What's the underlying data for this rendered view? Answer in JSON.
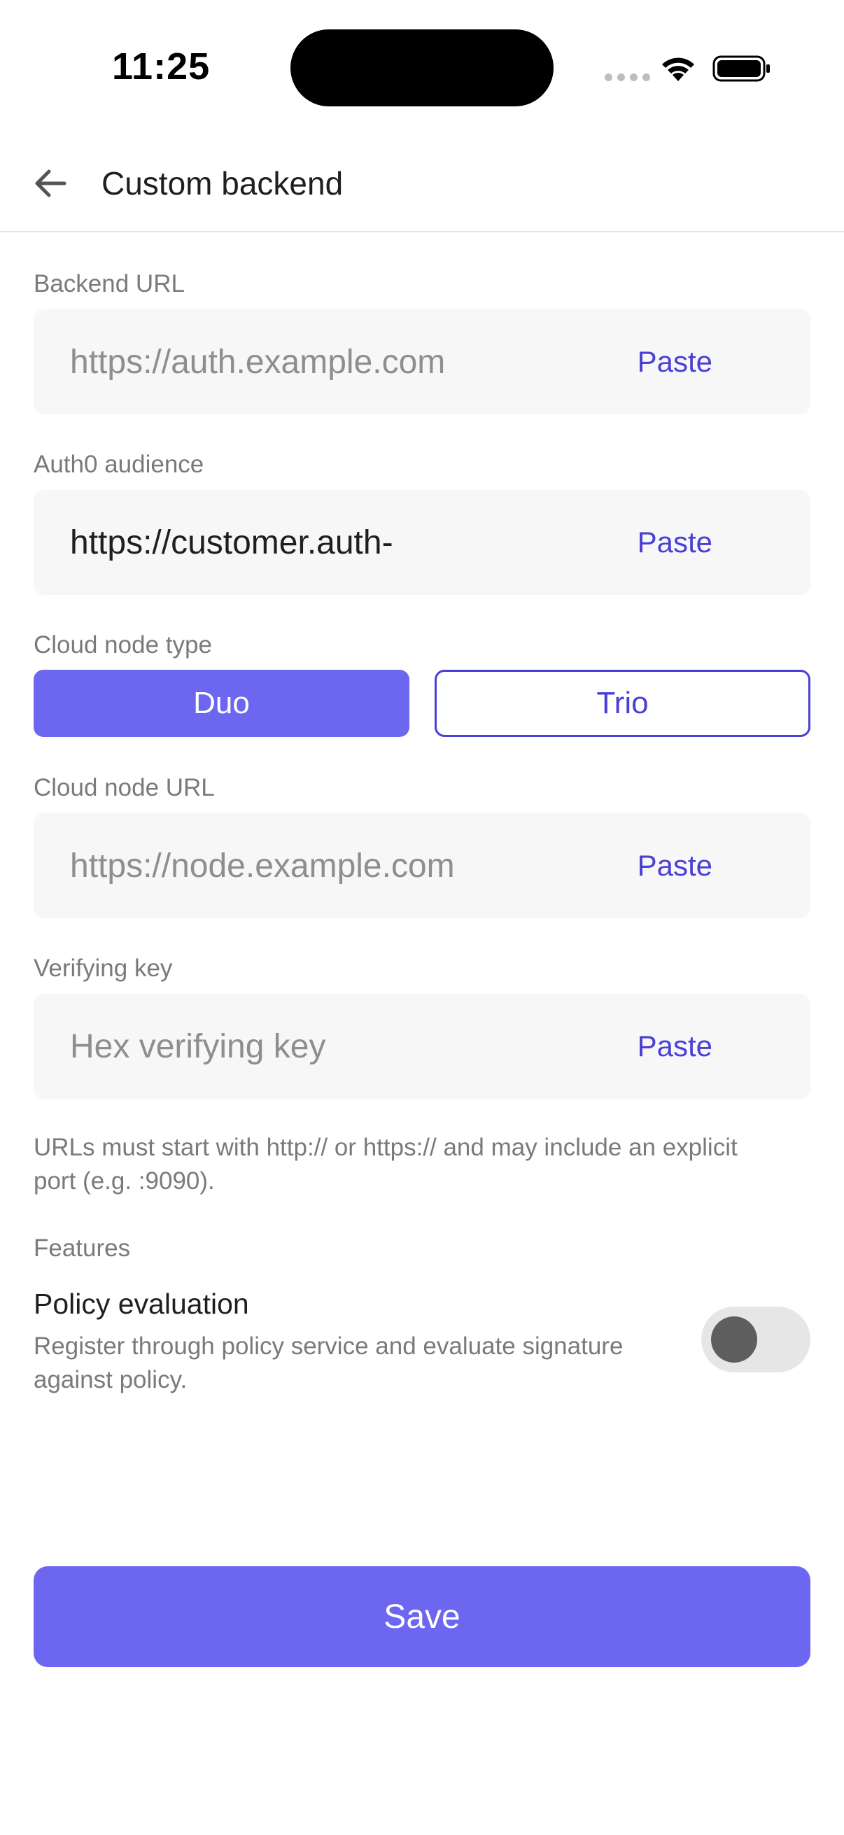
{
  "status_bar": {
    "time": "11:25",
    "icons": [
      "signal-dots-icon",
      "wifi-icon",
      "battery-icon"
    ]
  },
  "header": {
    "back_icon": "arrow-left-icon",
    "title": "Custom backend"
  },
  "form": {
    "backend_url": {
      "label": "Backend URL",
      "placeholder": "https://auth.example.com",
      "value": "",
      "paste_label": "Paste"
    },
    "auth0_audience": {
      "label": "Auth0 audience",
      "placeholder": "",
      "value": "https://customer.auth-",
      "paste_label": "Paste"
    },
    "cloud_node_type": {
      "label": "Cloud node type",
      "options": [
        "Duo",
        "Trio"
      ],
      "selected": "Duo"
    },
    "cloud_node_url": {
      "label": "Cloud node URL",
      "placeholder": "https://node.example.com",
      "value": "",
      "paste_label": "Paste"
    },
    "verifying_key": {
      "label": "Verifying key",
      "placeholder": "Hex verifying key",
      "value": "",
      "paste_label": "Paste"
    },
    "help_text": "URLs must start with http:// or https:// and may include an explicit port (e.g. :9090)."
  },
  "features": {
    "section_label": "Features",
    "policy_evaluation": {
      "title": "Policy evaluation",
      "description": "Register through policy service and evaluate signature against policy.",
      "enabled": false
    }
  },
  "actions": {
    "save_label": "Save"
  },
  "colors": {
    "accent": "#6c66f0",
    "accent_text": "#4a3fd6",
    "field_background": "#f7f7f7",
    "label_text": "#7a7a7a"
  }
}
